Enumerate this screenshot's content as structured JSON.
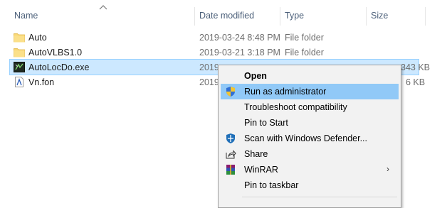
{
  "columns": {
    "name": "Name",
    "date": "Date modified",
    "type": "Type",
    "size": "Size"
  },
  "files": [
    {
      "name": "Auto",
      "date": "2019-03-24 8:48 PM",
      "type": "File folder",
      "size": "",
      "icon": "folder-icon"
    },
    {
      "name": "AutoVLBS1.0",
      "date": "2019-03-21 3:18 PM",
      "type": "File folder",
      "size": "",
      "icon": "folder-icon"
    },
    {
      "name": "AutoLocDo.exe",
      "date": "2019-",
      "type": "",
      "size": "343 KB",
      "icon": "exe-icon"
    },
    {
      "name": "Vn.fon",
      "date": "2019-",
      "type": "",
      "size": "6 KB",
      "icon": "font-file-icon"
    }
  ],
  "context_menu": {
    "items": [
      {
        "label": "Open",
        "icon": ""
      },
      {
        "label": "Run as administrator",
        "icon": "uac-shield-icon"
      },
      {
        "label": "Troubleshoot compatibility",
        "icon": ""
      },
      {
        "label": "Pin to Start",
        "icon": ""
      },
      {
        "label": "Scan with Windows Defender...",
        "icon": "defender-icon"
      },
      {
        "label": "Share",
        "icon": "share-icon"
      },
      {
        "label": "WinRAR",
        "icon": "winrar-icon",
        "submenu_arrow": "›"
      },
      {
        "label": "Pin to taskbar",
        "icon": ""
      }
    ]
  },
  "colors": {
    "selection": "#cce8ff",
    "menu_highlight": "#91c9f7",
    "folder": "#f8d775"
  }
}
